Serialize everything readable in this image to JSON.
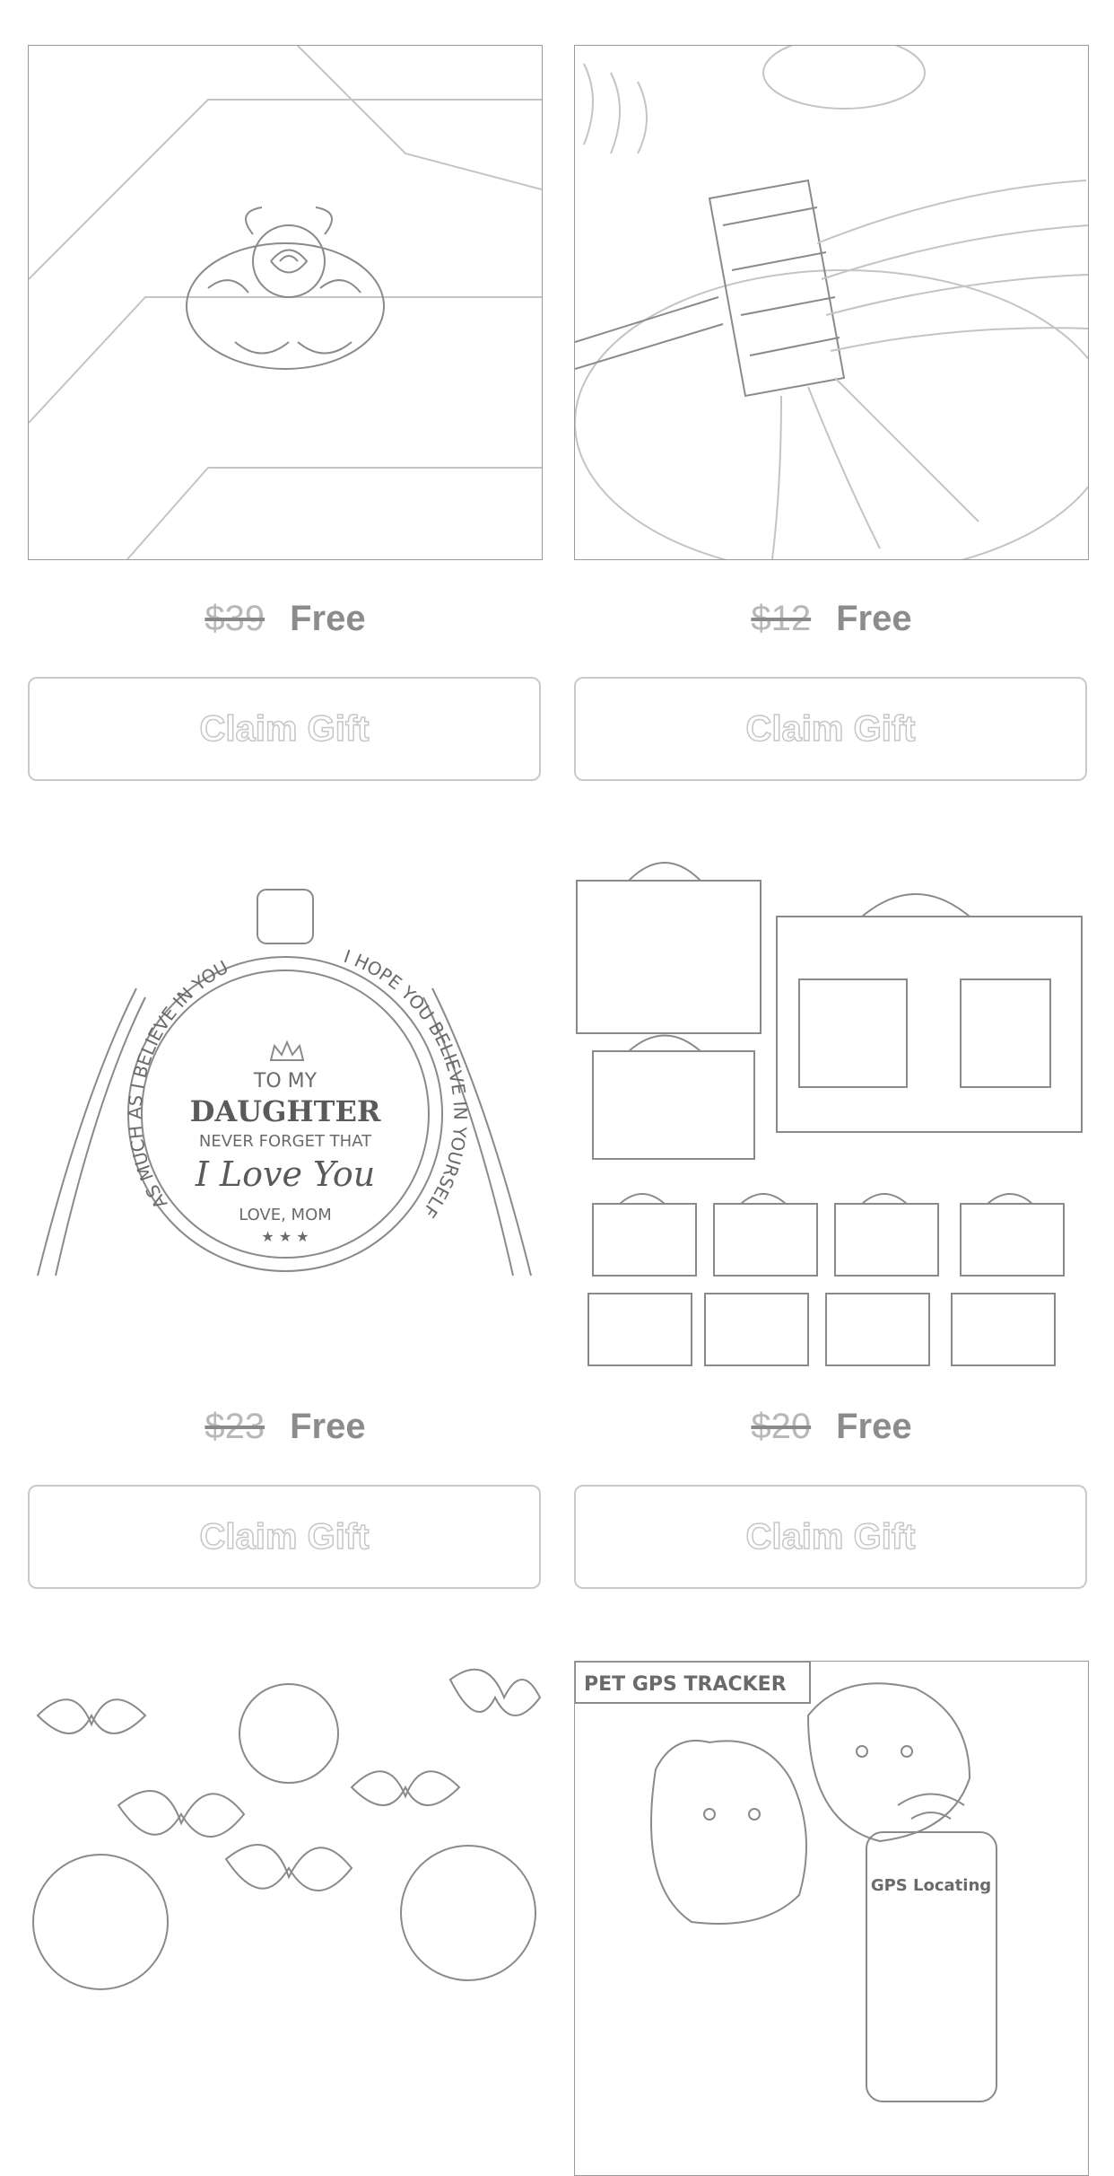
{
  "products": [
    {
      "old_price": "$39",
      "new_price": "Free",
      "button_label": "Claim Gift",
      "image": "rose-ring"
    },
    {
      "old_price": "$12",
      "new_price": "Free",
      "button_label": "Claim Gift",
      "image": "hair-brush"
    },
    {
      "old_price": "$23",
      "new_price": "Free",
      "button_label": "Claim Gift",
      "image": "daughter-necklace"
    },
    {
      "old_price": "$20",
      "new_price": "Free",
      "button_label": "Claim Gift",
      "image": "bag-organizer"
    },
    {
      "image": "hair-bows"
    },
    {
      "image": "pet-gps-tracker"
    }
  ],
  "necklace": {
    "line1": "TO MY",
    "line2": "DAUGHTER",
    "line3": "NEVER FORGET THAT",
    "line4": "I Love You",
    "line5": "LOVE, MOM",
    "ring_left": "AS MUCH AS I BELIEVE IN YOU",
    "ring_right": "I HOPE YOU BELIEVE IN YOURSELF",
    "stars": "★ ★ ★"
  },
  "pet_tracker": {
    "banner": "PET GPS TRACKER",
    "phone_label": "GPS Locating"
  }
}
